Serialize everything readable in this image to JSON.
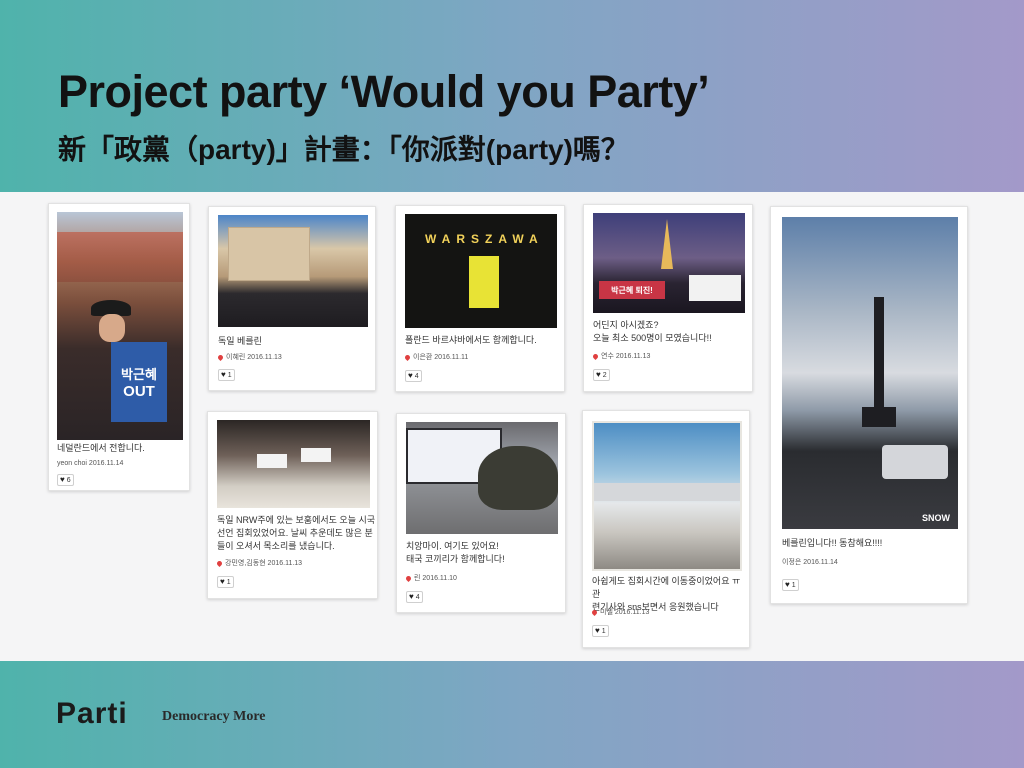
{
  "header": {
    "title": "Project party ‘Would you Party’",
    "subtitle": "新「政黨（party)」計畫：「你派對(party)嗎？"
  },
  "footer": {
    "logo": "Parti",
    "tagline": "Democracy More"
  },
  "colors": {
    "gradient_start": "#4fb3ab",
    "gradient_end": "#a399c9",
    "pin": "#e04040"
  },
  "cards": [
    {
      "caption": "네덜란드에서 전합니다.",
      "author": "yeon choi",
      "date": "2016.11.14",
      "likes": "6",
      "photo_text": {
        "sign_line1": "박근혜",
        "sign_line2": "OUT"
      }
    },
    {
      "caption": "독일 베를린",
      "author": "이혜린",
      "date": "2016.11.13",
      "likes": "1"
    },
    {
      "caption": "폴란드 바르샤바에서도 함께합니다.",
      "author": "이은환",
      "date": "2016.11.11",
      "likes": "4",
      "photo_text": {
        "sign": "WARSZAWA"
      }
    },
    {
      "caption": "어딘지 아시겠죠?\n오늘 최소 500명이 모였습니다!!",
      "author": "연수",
      "date": "2016.11.13",
      "likes": "2",
      "photo_text": {
        "banner": "박근혜 퇴진!"
      }
    },
    {
      "caption": "베를린입니다!! 동참해요!!!!",
      "author": "이정은",
      "date": "2016.11.14",
      "likes": "1",
      "photo_text": {
        "watermark": "SNOW"
      }
    },
    {
      "caption": "독일 NRW주에 있는 보훔에서도 오늘 시국\n선언 집회있었어요. 날씨 추운데도 많은 분\n들이 오셔서 목소리를 냈습니다.",
      "author": "강민영,김동현",
      "date": "2016.11.13",
      "likes": "1"
    },
    {
      "caption": "치앙마이. 여기도 있어요!\n태국 코끼리가 함께합니다!",
      "author": "린",
      "date": "2016.11.10",
      "likes": "4"
    },
    {
      "caption": "아쉽게도 집회시간에 이동중이었어요 ㅠ 관\n련기사와 sns보면서 응원했습니다",
      "author": "미셸",
      "date": "2016.11.13",
      "likes": "1"
    }
  ]
}
